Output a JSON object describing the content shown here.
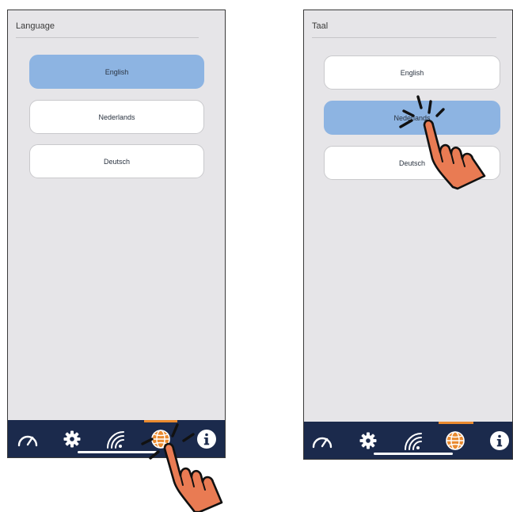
{
  "left_screen": {
    "title": "Language",
    "options": [
      {
        "label": "English",
        "selected": true
      },
      {
        "label": "Nederlands",
        "selected": false
      },
      {
        "label": "Deutsch",
        "selected": false
      }
    ],
    "active_tab": "language"
  },
  "right_screen": {
    "title": "Taal",
    "options": [
      {
        "label": "English",
        "selected": false
      },
      {
        "label": "Nederlands",
        "selected": true
      },
      {
        "label": "Deutsch",
        "selected": false
      }
    ],
    "active_tab": "language"
  },
  "tabbar": {
    "tabs": [
      {
        "id": "dashboard",
        "icon": "speedometer-icon"
      },
      {
        "id": "settings",
        "icon": "gear-icon"
      },
      {
        "id": "wifi",
        "icon": "wifi-icon"
      },
      {
        "id": "language",
        "icon": "globe-icon"
      },
      {
        "id": "info",
        "icon": "info-icon"
      }
    ]
  },
  "colors": {
    "background": "#e6e5e8",
    "selected_button": "#8db4e2",
    "tabbar": "#1b2a4c",
    "accent": "#e98a2f",
    "hand": "#e97b53"
  }
}
